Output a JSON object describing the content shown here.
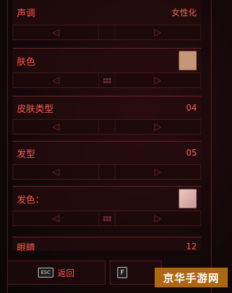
{
  "rows": [
    {
      "label": "声调",
      "value": "女性化",
      "has_swatch": false,
      "center_icon": false
    },
    {
      "label": "肤色",
      "value": "",
      "has_swatch": true,
      "swatch": "#c79578",
      "center_icon": true
    },
    {
      "label": "皮肤类型",
      "value": "04",
      "has_swatch": false,
      "center_icon": false
    },
    {
      "label": "发型",
      "value": "05",
      "has_swatch": false,
      "center_icon": false
    },
    {
      "label": "发色：",
      "value": "",
      "has_swatch": true,
      "swatch": "#d9b7b3",
      "center_icon": true
    },
    {
      "label": "眼睛",
      "value": "12",
      "has_swatch": false,
      "center_icon": false
    }
  ],
  "nav": {
    "left": "◁",
    "right": "▷"
  },
  "footer": {
    "back_key": "ESC",
    "back_label": "返回",
    "f_key": "F"
  },
  "watermark": "京华手游网",
  "colors": {
    "accent": "#ff5a50",
    "bg": "#0d0708",
    "border": "#6b1f25"
  }
}
